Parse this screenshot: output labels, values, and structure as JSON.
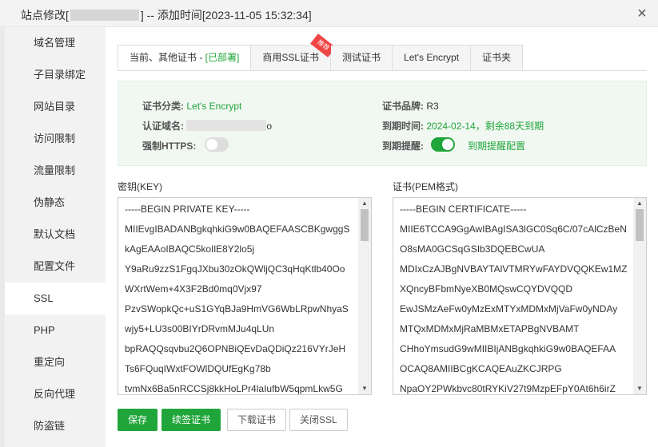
{
  "window": {
    "title_prefix": "站点修改[",
    "title_suffix": "] -- 添加时间[2023-11-05 15:32:34]",
    "close_glyph": "×"
  },
  "sidebar": {
    "items": [
      {
        "label": "域名管理"
      },
      {
        "label": "子目录绑定"
      },
      {
        "label": "网站目录"
      },
      {
        "label": "访问限制"
      },
      {
        "label": "流量限制"
      },
      {
        "label": "伪静态"
      },
      {
        "label": "默认文档"
      },
      {
        "label": "配置文件"
      },
      {
        "label": "SSL"
      },
      {
        "label": "PHP"
      },
      {
        "label": "重定向"
      },
      {
        "label": "反向代理"
      },
      {
        "label": "防盗链"
      }
    ],
    "active": "SSL"
  },
  "tabs": {
    "current": "当前、其他证书 - ",
    "current_status": "[已部署]",
    "commercial": "商用SSL证书",
    "recommend_badge": "推荐",
    "test": "测试证书",
    "letsencrypt": "Let's Encrypt",
    "folder": "证书夹"
  },
  "cert_info": {
    "category_label": "证书分类:",
    "category_value": "Let's Encrypt",
    "brand_label": "证书品牌:",
    "brand_value": "R3",
    "domain_label": "认证域名:",
    "domain_tail": "o",
    "expire_label": "到期时间:",
    "expire_value": "2024-02-14，剩余88天到期",
    "https_label": "强制HTTPS:",
    "https_on": false,
    "remind_label": "到期提醒:",
    "remind_on": true,
    "remind_link": "到期提醒配置"
  },
  "key": {
    "label": "密钥(KEY)",
    "lines": [
      "-----BEGIN PRIVATE KEY-----",
      "MIIEvgIBADANBgkqhkiG9w0BAQEFAASCBKgwggS",
      "kAgEAAoIBAQC5koIlE8Y2lo5j",
      "Y9aRu9zzS1FgqJXbu30zOkQWljQC3qHqKtlb40Oo",
      "WXrtWem+4X3F2Bd0mq0Vjx97",
      "PzvSWopkQc+uS1GYqBJa9HmVG6WbLRpwNhyaS",
      "wjy5+LU3s00BIYrDRvmMJu4qLUn",
      "bpRAQQsqvbu2Q6OPNBiQEvDaQDiQz216VYrJeH",
      "Ts6FQuqIWxtFOWlDQUfEgKg78b",
      "tvmNx6Ba5nRCCSj8kkHoLPr4laIufbW5qpmLkw5G"
    ]
  },
  "cert": {
    "label": "证书(PEM格式)",
    "lines": [
      "-----BEGIN CERTIFICATE-----",
      "MIIE6TCCA9GgAwIBAgISA3lGC0Sq6C/07cAlCzBeN",
      "O8sMA0GCSqGSIb3DQEBCwUA",
      "MDIxCzAJBgNVBAYTAlVTMRYwFAYDVQQKEw1MZ",
      "XQncyBFbmNyeXB0MQswCQYDVQQD",
      "EwJSMzAeFw0yMzExMTYxMDMxMjVaFw0yNDAy",
      "MTQxMDMxMjRaMBMxETAPBgNVBAMT",
      "CHhoYmsudG9wMIIBIjANBgkqhkiG9w0BAQEFAA",
      "OCAQ8AMIIBCgKCAQEAuZKCJRPG",
      "NpaOY2PWkbvc80tRYKiV27t9MzpEFpY0At6h6irZ"
    ]
  },
  "buttons": {
    "save": "保存",
    "renew": "续签证书",
    "download": "下载证书",
    "close_ssl": "关闭SSL"
  }
}
